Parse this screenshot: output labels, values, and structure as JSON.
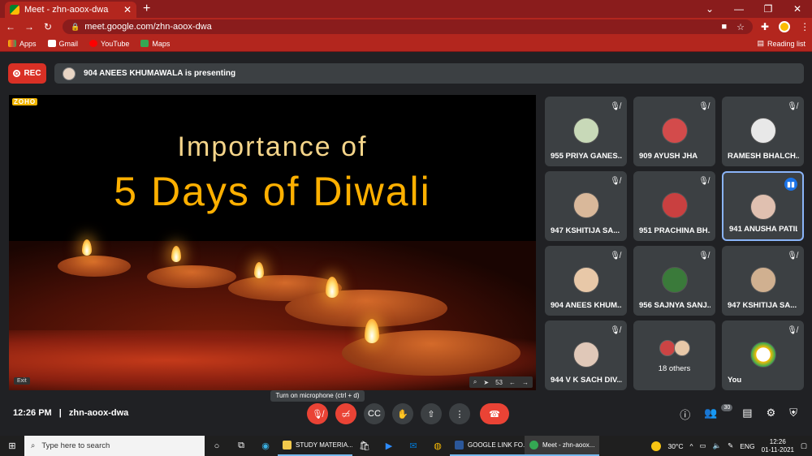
{
  "browser": {
    "tab_title": "Meet - zhn-aoox-dwa",
    "tab_close": "✕",
    "new_tab": "+",
    "url": "meet.google.com/zhn-aoox-dwa",
    "bookmarks": [
      "Apps",
      "Gmail",
      "YouTube",
      "Maps"
    ],
    "reading_list": "Reading list"
  },
  "meet": {
    "rec_label": "REC",
    "presenting_text": "904 ANEES KHUMAWALA is presenting",
    "time": "12:26 PM",
    "separator": "|",
    "meeting_code": "zhn-aoox-dwa",
    "tooltip": "Turn on microphone (ctrl + d)",
    "participants_count": "30"
  },
  "slide": {
    "logo": "ZOHO",
    "title_line1": "Importance of",
    "title_line2": "5 Days of Diwali",
    "exit_label": "Exit",
    "zoom_label": "53"
  },
  "participants": [
    {
      "name": "955 PRIYA GANES...",
      "muted": true,
      "avatar_color": "#c8d9b8"
    },
    {
      "name": "909 AYUSH JHA",
      "muted": true,
      "avatar_color": "#d34b4b"
    },
    {
      "name": "RAMESH BHALCH...",
      "muted": true,
      "avatar_color": "#e8e8e8"
    },
    {
      "name": "947 KSHITIJA SA...",
      "muted": true,
      "avatar_color": "#d9b89a"
    },
    {
      "name": "951 PRACHINA BH...",
      "muted": true,
      "avatar_color": "#c94040"
    },
    {
      "name": "941 ANUSHA PATIL",
      "muted": false,
      "avatar_color": "#e0c0b0"
    },
    {
      "name": "904 ANEES KHUM...",
      "muted": true,
      "avatar_color": "#e8c8a8"
    },
    {
      "name": "956 SAJNYA SANJ...",
      "muted": true,
      "avatar_color": "#3a7a3a"
    },
    {
      "name": "947 KSHITIJA SA...",
      "muted": true,
      "avatar_color": "#d0b090"
    },
    {
      "name": "944 V K SACH DIV...",
      "muted": true,
      "avatar_color": "#e0c8b8"
    },
    {
      "name": "18 others",
      "muted": false,
      "avatar_color": "#c44"
    },
    {
      "name": "You",
      "muted": true,
      "avatar_color": "#fbbc04"
    }
  ],
  "taskbar": {
    "search_placeholder": "Type here to search",
    "apps": [
      {
        "label": "STUDY MATERIA...",
        "color": "#f2c94c"
      },
      {
        "label": "GOOGLE LINK FO...",
        "color": "#2b579a"
      },
      {
        "label": "Meet - zhn-aoox...",
        "color": "#34a853"
      }
    ],
    "weather": "30°C",
    "lang": "ENG",
    "clock_time": "12:26",
    "clock_date": "01-11-2021"
  }
}
